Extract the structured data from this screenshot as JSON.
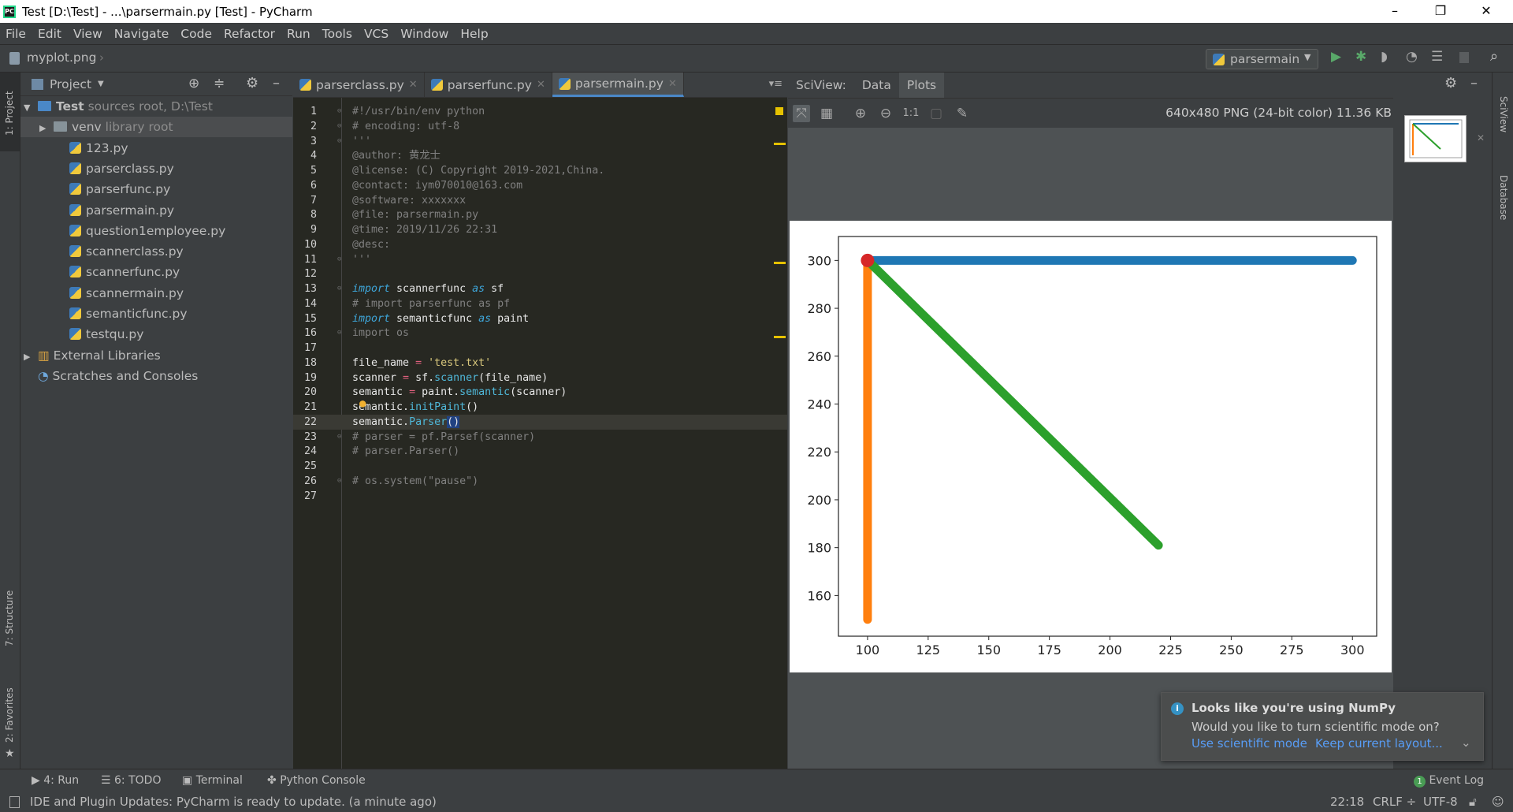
{
  "window": {
    "title": "Test [D:\\Test] - ...\\parsermain.py [Test] - PyCharm",
    "minimize": "–",
    "maximize": "❐",
    "close": "✕"
  },
  "menu": [
    "File",
    "Edit",
    "View",
    "Navigate",
    "Code",
    "Refactor",
    "Run",
    "Tools",
    "VCS",
    "Window",
    "Help"
  ],
  "nav": {
    "breadcrumb": "myplot.png",
    "run_config": "parsermain"
  },
  "left_strip": {
    "project": "1: Project",
    "structure": "7: Structure",
    "favorites": "2: Favorites"
  },
  "right_strip": {
    "sciview": "SciView",
    "database": "Database"
  },
  "project": {
    "title": "Project",
    "tree": [
      {
        "label": "Test",
        "hint": "sources root, D:\\Test",
        "type": "root",
        "depth": 0,
        "arrow": "▼"
      },
      {
        "label": "venv",
        "hint": "library root",
        "type": "folder",
        "depth": 1,
        "arrow": "▶",
        "selected": true
      },
      {
        "label": "123.py",
        "type": "py",
        "depth": 2
      },
      {
        "label": "parserclass.py",
        "type": "py",
        "depth": 2
      },
      {
        "label": "parserfunc.py",
        "type": "py",
        "depth": 2
      },
      {
        "label": "parsermain.py",
        "type": "py",
        "depth": 2
      },
      {
        "label": "question1employee.py",
        "type": "py",
        "depth": 2
      },
      {
        "label": "scannerclass.py",
        "type": "py",
        "depth": 2
      },
      {
        "label": "scannerfunc.py",
        "type": "py",
        "depth": 2
      },
      {
        "label": "scannermain.py",
        "type": "py",
        "depth": 2
      },
      {
        "label": "semanticfunc.py",
        "type": "py",
        "depth": 2
      },
      {
        "label": "testqu.py",
        "type": "py",
        "depth": 2
      },
      {
        "label": "External Libraries",
        "type": "lib",
        "depth": 0,
        "arrow": "▶"
      },
      {
        "label": "Scratches and Consoles",
        "type": "scratch",
        "depth": 0
      }
    ]
  },
  "editor": {
    "tabs": [
      {
        "label": "parserclass.py"
      },
      {
        "label": "parserfunc.py"
      },
      {
        "label": "parsermain.py",
        "active": true
      }
    ],
    "current_line": 22,
    "lines": [
      [
        [
          "#!/usr/bin/env python",
          "cm"
        ]
      ],
      [
        [
          "# encoding: utf-8",
          "cm"
        ]
      ],
      [
        [
          "'''",
          "cm"
        ]
      ],
      [
        [
          "@author: 黄龙士",
          "cm"
        ]
      ],
      [
        [
          "@license: (C) Copyright 2019-2021,China.",
          "cm"
        ]
      ],
      [
        [
          "@contact: iym070010@163.com",
          "cm"
        ]
      ],
      [
        [
          "@software: xxxxxxx",
          "cm"
        ]
      ],
      [
        [
          "@file: parsermain.py",
          "cm"
        ]
      ],
      [
        [
          "@time: 2019/11/26 22:31",
          "cm"
        ]
      ],
      [
        [
          "@desc:",
          "cm"
        ]
      ],
      [
        [
          "'''",
          "cm"
        ]
      ],
      [],
      [
        [
          "import",
          "kw"
        ],
        [
          " scannerfunc ",
          "tx"
        ],
        [
          "as",
          "kw"
        ],
        [
          " sf",
          "tx"
        ]
      ],
      [
        [
          "# import parserfunc as pf",
          "cm"
        ]
      ],
      [
        [
          "import",
          "kw"
        ],
        [
          " semanticfunc ",
          "tx"
        ],
        [
          "as",
          "kw"
        ],
        [
          " paint",
          "tx"
        ]
      ],
      [
        [
          "import os",
          "cm"
        ]
      ],
      [],
      [
        [
          "file_name ",
          "tx"
        ],
        [
          "=",
          "op"
        ],
        [
          " ",
          "tx"
        ],
        [
          "'test.txt'",
          "st"
        ]
      ],
      [
        [
          "scanner ",
          "tx"
        ],
        [
          "=",
          "op"
        ],
        [
          " sf.",
          "tx"
        ],
        [
          "scanner",
          "fn"
        ],
        [
          "(file_name)",
          "tx"
        ]
      ],
      [
        [
          "semantic ",
          "tx"
        ],
        [
          "=",
          "op"
        ],
        [
          " paint.",
          "tx"
        ],
        [
          "semantic",
          "fn"
        ],
        [
          "(scanner)",
          "tx"
        ]
      ],
      [
        [
          "semantic.",
          "tx"
        ],
        [
          "initPaint",
          "fn"
        ],
        [
          "()",
          "tx"
        ]
      ],
      [
        [
          "semantic.",
          "tx"
        ],
        [
          "Parser",
          "fn"
        ],
        [
          "()",
          "br"
        ]
      ],
      [
        [
          "# parser = pf.Parsef(scanner)",
          "cm"
        ]
      ],
      [
        [
          "# parser.Parser()",
          "cm"
        ]
      ],
      [],
      [
        [
          "# os.system(\"pause\")",
          "cm"
        ]
      ],
      []
    ]
  },
  "sciview": {
    "label": "SciView:",
    "tabs": [
      "Data",
      "Plots"
    ],
    "active_tab": "Plots",
    "image_info": "640x480 PNG (24-bit color) 11.36 KB"
  },
  "chart_data": {
    "type": "scatter",
    "xlim": [
      88,
      310
    ],
    "ylim": [
      143,
      310
    ],
    "xticks": [
      100,
      125,
      150,
      175,
      200,
      225,
      250,
      275,
      300
    ],
    "yticks": [
      160,
      180,
      200,
      220,
      240,
      260,
      280,
      300
    ],
    "grid": false,
    "series": [
      {
        "color": "#1f77b4",
        "x": [
          100,
          300
        ],
        "y": [
          300,
          300
        ]
      },
      {
        "color": "#ff7f0e",
        "x": [
          100,
          100
        ],
        "y": [
          300,
          150
        ]
      },
      {
        "color": "#2ca02c",
        "x": [
          100,
          220
        ],
        "y": [
          300,
          181
        ]
      },
      {
        "color": "#d62728",
        "x": [
          100
        ],
        "y": [
          300
        ]
      }
    ]
  },
  "notification": {
    "title": "Looks like you're using NumPy",
    "body": "Would you like to turn scientific mode on?",
    "action1": "Use scientific mode",
    "action2": "Keep current layout..."
  },
  "bottom_tools": {
    "run": "4: Run",
    "todo": "6: TODO",
    "terminal": "Terminal",
    "console": "Python Console",
    "event_log": "Event Log",
    "event_count": "1"
  },
  "status": {
    "message": "IDE and Plugin Updates: PyCharm is ready to update. (a minute ago)",
    "position": "22:18",
    "line_sep": "CRLF ÷",
    "encoding": "UTF-8"
  }
}
